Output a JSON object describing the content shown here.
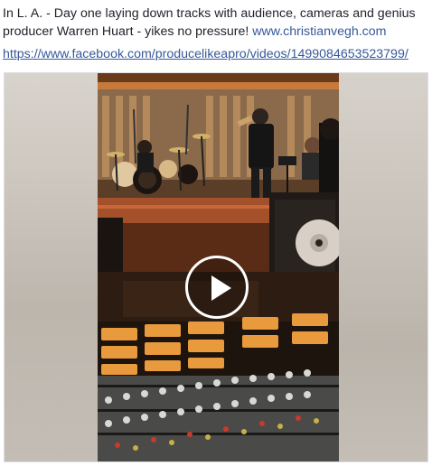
{
  "post": {
    "text": "In L. A. - Day one laying down tracks with audience, cameras and genius producer Warren Huart - yikes no pressure!",
    "inline_link": "www.christianvegh.com",
    "video_link": "https://www.facebook.com/producelikeapro/videos/1499084653523799/"
  },
  "video": {
    "state": "paused",
    "play_icon": "play-icon"
  },
  "colors": {
    "text": "#1d2129",
    "link": "#365899"
  }
}
